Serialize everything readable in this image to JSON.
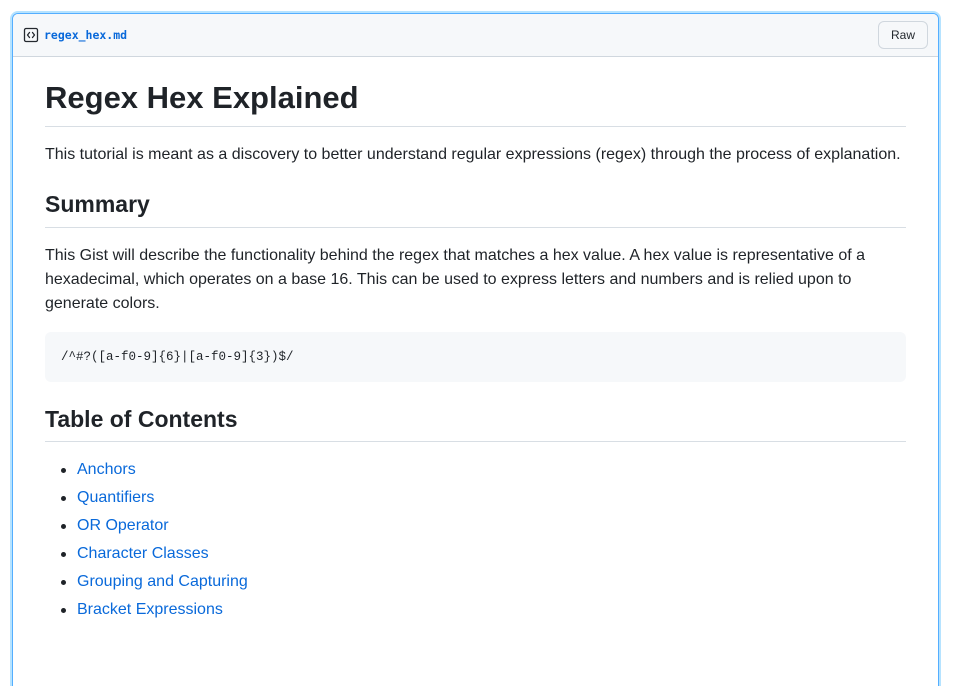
{
  "file": {
    "name": "regex_hex.md",
    "raw_label": "Raw"
  },
  "content": {
    "title": "Regex Hex Explained",
    "intro": "This tutorial is meant as a discovery to better understand regular expressions (regex) through the process of explanation.",
    "summary_heading": "Summary",
    "summary_text": "This Gist will describe the functionality behind the regex that matches a hex value. A hex value is representative of a hexadecimal, which operates on a base 16. This can be used to express letters and numbers and is relied upon to generate colors.",
    "code": "/^#?([a-f0-9]{6}|[a-f0-9]{3})$/",
    "toc_heading": "Table of Contents",
    "toc": [
      "Anchors",
      "Quantifiers",
      "OR Operator",
      "Character Classes",
      "Grouping and Capturing",
      "Bracket Expressions"
    ]
  },
  "icons": {
    "file_icon": "code-file-icon"
  },
  "colors": {
    "link": "#0969da",
    "focus_border": "#54aeff",
    "code_bg": "#f6f8fa"
  }
}
